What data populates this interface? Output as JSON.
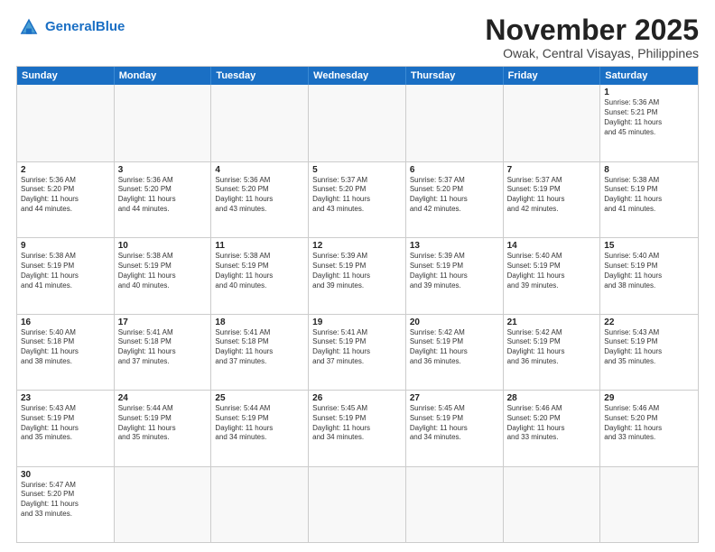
{
  "header": {
    "logo_general": "General",
    "logo_blue": "Blue",
    "title": "November 2025",
    "subtitle": "Owak, Central Visayas, Philippines"
  },
  "calendar": {
    "days": [
      "Sunday",
      "Monday",
      "Tuesday",
      "Wednesday",
      "Thursday",
      "Friday",
      "Saturday"
    ],
    "rows": [
      [
        {
          "day": "",
          "text": ""
        },
        {
          "day": "",
          "text": ""
        },
        {
          "day": "",
          "text": ""
        },
        {
          "day": "",
          "text": ""
        },
        {
          "day": "",
          "text": ""
        },
        {
          "day": "",
          "text": ""
        },
        {
          "day": "1",
          "text": "Sunrise: 5:36 AM\nSunset: 5:21 PM\nDaylight: 11 hours\nand 45 minutes."
        }
      ],
      [
        {
          "day": "2",
          "text": "Sunrise: 5:36 AM\nSunset: 5:20 PM\nDaylight: 11 hours\nand 44 minutes."
        },
        {
          "day": "3",
          "text": "Sunrise: 5:36 AM\nSunset: 5:20 PM\nDaylight: 11 hours\nand 44 minutes."
        },
        {
          "day": "4",
          "text": "Sunrise: 5:36 AM\nSunset: 5:20 PM\nDaylight: 11 hours\nand 43 minutes."
        },
        {
          "day": "5",
          "text": "Sunrise: 5:37 AM\nSunset: 5:20 PM\nDaylight: 11 hours\nand 43 minutes."
        },
        {
          "day": "6",
          "text": "Sunrise: 5:37 AM\nSunset: 5:20 PM\nDaylight: 11 hours\nand 42 minutes."
        },
        {
          "day": "7",
          "text": "Sunrise: 5:37 AM\nSunset: 5:19 PM\nDaylight: 11 hours\nand 42 minutes."
        },
        {
          "day": "8",
          "text": "Sunrise: 5:38 AM\nSunset: 5:19 PM\nDaylight: 11 hours\nand 41 minutes."
        }
      ],
      [
        {
          "day": "9",
          "text": "Sunrise: 5:38 AM\nSunset: 5:19 PM\nDaylight: 11 hours\nand 41 minutes."
        },
        {
          "day": "10",
          "text": "Sunrise: 5:38 AM\nSunset: 5:19 PM\nDaylight: 11 hours\nand 40 minutes."
        },
        {
          "day": "11",
          "text": "Sunrise: 5:38 AM\nSunset: 5:19 PM\nDaylight: 11 hours\nand 40 minutes."
        },
        {
          "day": "12",
          "text": "Sunrise: 5:39 AM\nSunset: 5:19 PM\nDaylight: 11 hours\nand 39 minutes."
        },
        {
          "day": "13",
          "text": "Sunrise: 5:39 AM\nSunset: 5:19 PM\nDaylight: 11 hours\nand 39 minutes."
        },
        {
          "day": "14",
          "text": "Sunrise: 5:40 AM\nSunset: 5:19 PM\nDaylight: 11 hours\nand 39 minutes."
        },
        {
          "day": "15",
          "text": "Sunrise: 5:40 AM\nSunset: 5:19 PM\nDaylight: 11 hours\nand 38 minutes."
        }
      ],
      [
        {
          "day": "16",
          "text": "Sunrise: 5:40 AM\nSunset: 5:18 PM\nDaylight: 11 hours\nand 38 minutes."
        },
        {
          "day": "17",
          "text": "Sunrise: 5:41 AM\nSunset: 5:18 PM\nDaylight: 11 hours\nand 37 minutes."
        },
        {
          "day": "18",
          "text": "Sunrise: 5:41 AM\nSunset: 5:18 PM\nDaylight: 11 hours\nand 37 minutes."
        },
        {
          "day": "19",
          "text": "Sunrise: 5:41 AM\nSunset: 5:19 PM\nDaylight: 11 hours\nand 37 minutes."
        },
        {
          "day": "20",
          "text": "Sunrise: 5:42 AM\nSunset: 5:19 PM\nDaylight: 11 hours\nand 36 minutes."
        },
        {
          "day": "21",
          "text": "Sunrise: 5:42 AM\nSunset: 5:19 PM\nDaylight: 11 hours\nand 36 minutes."
        },
        {
          "day": "22",
          "text": "Sunrise: 5:43 AM\nSunset: 5:19 PM\nDaylight: 11 hours\nand 35 minutes."
        }
      ],
      [
        {
          "day": "23",
          "text": "Sunrise: 5:43 AM\nSunset: 5:19 PM\nDaylight: 11 hours\nand 35 minutes."
        },
        {
          "day": "24",
          "text": "Sunrise: 5:44 AM\nSunset: 5:19 PM\nDaylight: 11 hours\nand 35 minutes."
        },
        {
          "day": "25",
          "text": "Sunrise: 5:44 AM\nSunset: 5:19 PM\nDaylight: 11 hours\nand 34 minutes."
        },
        {
          "day": "26",
          "text": "Sunrise: 5:45 AM\nSunset: 5:19 PM\nDaylight: 11 hours\nand 34 minutes."
        },
        {
          "day": "27",
          "text": "Sunrise: 5:45 AM\nSunset: 5:19 PM\nDaylight: 11 hours\nand 34 minutes."
        },
        {
          "day": "28",
          "text": "Sunrise: 5:46 AM\nSunset: 5:20 PM\nDaylight: 11 hours\nand 33 minutes."
        },
        {
          "day": "29",
          "text": "Sunrise: 5:46 AM\nSunset: 5:20 PM\nDaylight: 11 hours\nand 33 minutes."
        }
      ],
      [
        {
          "day": "30",
          "text": "Sunrise: 5:47 AM\nSunset: 5:20 PM\nDaylight: 11 hours\nand 33 minutes."
        },
        {
          "day": "",
          "text": ""
        },
        {
          "day": "",
          "text": ""
        },
        {
          "day": "",
          "text": ""
        },
        {
          "day": "",
          "text": ""
        },
        {
          "day": "",
          "text": ""
        },
        {
          "day": "",
          "text": ""
        }
      ]
    ]
  }
}
